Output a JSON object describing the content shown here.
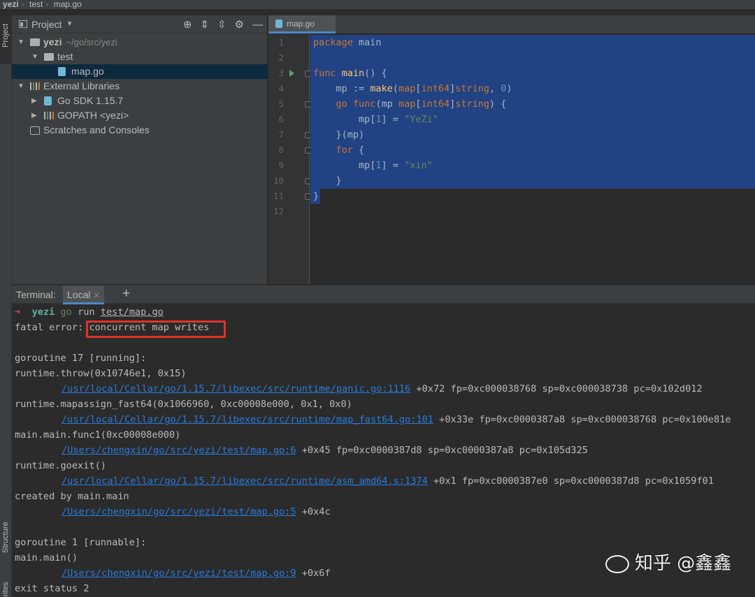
{
  "breadcrumb": {
    "items": [
      "yezi",
      "test",
      "map.go"
    ]
  },
  "sidebar": {
    "project_tab": "Project",
    "structure_tab": "Structure",
    "favorites_tab": "avorites"
  },
  "project_panel": {
    "title": "Project",
    "tree": [
      {
        "label": "yezi",
        "note": "~/go/src/yezi",
        "level": 0,
        "type": "folder",
        "expanded": true,
        "bold": true
      },
      {
        "label": "test",
        "level": 1,
        "type": "folder",
        "expanded": true
      },
      {
        "label": "map.go",
        "level": 2,
        "type": "go-file",
        "selected": true
      },
      {
        "label": "External Libraries",
        "level": 0,
        "type": "library",
        "expanded": true
      },
      {
        "label": "Go SDK 1.15.7",
        "level": 1,
        "type": "go-file",
        "expanded": false
      },
      {
        "label": "GOPATH <yezi>",
        "level": 1,
        "type": "library",
        "expanded": false
      },
      {
        "label": "Scratches and Consoles",
        "level": 0,
        "type": "scratch"
      }
    ]
  },
  "editor": {
    "tab_label": "map.go",
    "line_numbers": [
      "1",
      "2",
      "3",
      "4",
      "5",
      "6",
      "7",
      "8",
      "9",
      "10",
      "11",
      "12"
    ],
    "lines": [
      [
        [
          "kw",
          "package"
        ],
        [
          "t",
          " main"
        ]
      ],
      [],
      [
        [
          "kw",
          "func"
        ],
        [
          "t",
          " "
        ],
        [
          "fn",
          "main"
        ],
        [
          "t",
          "() {"
        ]
      ],
      [
        [
          "t",
          "    mp := "
        ],
        [
          "fn",
          "make"
        ],
        [
          "t",
          "("
        ],
        [
          "kw",
          "map"
        ],
        [
          "t",
          "["
        ],
        [
          "kw",
          "int64"
        ],
        [
          "t",
          "]"
        ],
        [
          "kw",
          "string"
        ],
        [
          "t",
          ", "
        ],
        [
          "nm",
          "0"
        ],
        [
          "t",
          ")"
        ]
      ],
      [
        [
          "t",
          "    "
        ],
        [
          "kw",
          "go"
        ],
        [
          "t",
          " "
        ],
        [
          "kw",
          "func"
        ],
        [
          "t",
          "(mp "
        ],
        [
          "kw",
          "map"
        ],
        [
          "t",
          "["
        ],
        [
          "kw",
          "int64"
        ],
        [
          "t",
          "]"
        ],
        [
          "kw",
          "string"
        ],
        [
          "t",
          ") {"
        ]
      ],
      [
        [
          "t",
          "        mp["
        ],
        [
          "nm",
          "1"
        ],
        [
          "t",
          "] = "
        ],
        [
          "st",
          "\"YeZi\""
        ]
      ],
      [
        [
          "t",
          "    }(mp)"
        ]
      ],
      [
        [
          "t",
          "    "
        ],
        [
          "kw",
          "for"
        ],
        [
          "t",
          " {"
        ]
      ],
      [
        [
          "t",
          "        mp["
        ],
        [
          "nm",
          "1"
        ],
        [
          "t",
          "] = "
        ],
        [
          "st",
          "\"xin\""
        ]
      ],
      [
        [
          "t",
          "    }"
        ]
      ],
      [
        [
          "t",
          "}"
        ]
      ],
      []
    ]
  },
  "terminal": {
    "label": "Terminal:",
    "tab": "Local",
    "prompt_arrow": "➜",
    "prompt_dir": "yezi",
    "prompt_cmd": "go",
    "prompt_run": "run",
    "prompt_file": "test/map.go",
    "fatal_prefix": "fatal error: ",
    "fatal_msg": "concurrent map writes",
    "lines": [
      {
        "text": "goroutine 17 [running]:"
      },
      {
        "text": "runtime.throw(0x10746e1, 0x15)"
      },
      {
        "link": "/usr/local/Cellar/go/1.15.7/libexec/src/runtime/panic.go:1116",
        "rest": " +0x72 fp=0xc000038768 sp=0xc000038738 pc=0x102d012",
        "indent": true
      },
      {
        "text": "runtime.mapassign_fast64(0x1066960, 0xc00008e000, 0x1, 0x0)"
      },
      {
        "link": "/usr/local/Cellar/go/1.15.7/libexec/src/runtime/map_fast64.go:101",
        "rest": " +0x33e fp=0xc0000387a8 sp=0xc000038768 pc=0x100e81e",
        "indent": true
      },
      {
        "text": "main.main.func1(0xc00008e000)"
      },
      {
        "link": "/Users/chengxin/go/src/yezi/test/map.go:6",
        "rest": " +0x45 fp=0xc0000387d8 sp=0xc0000387a8 pc=0x105d325",
        "indent": true
      },
      {
        "text": "runtime.goexit()"
      },
      {
        "link": "/usr/local/Cellar/go/1.15.7/libexec/src/runtime/asm_amd64.s:1374",
        "rest": " +0x1 fp=0xc0000387e0 sp=0xc0000387d8 pc=0x1059f01",
        "indent": true
      },
      {
        "text": "created by main.main"
      },
      {
        "link": "/Users/chengxin/go/src/yezi/test/map.go:5",
        "rest": " +0x4c",
        "indent": true
      },
      {
        "text": ""
      },
      {
        "text": "goroutine 1 [runnable]:"
      },
      {
        "text": "main.main()"
      },
      {
        "link": "/Users/chengxin/go/src/yezi/test/map.go:9",
        "rest": " +0x6f",
        "indent": true
      },
      {
        "text": "exit status 2"
      }
    ]
  },
  "watermark": "知乎 @鑫鑫",
  "colors": {
    "selection": "#214283",
    "keyword": "#cc7832",
    "function": "#ffc66d",
    "string": "#6a8759",
    "number": "#6897bb",
    "link": "#287bde",
    "highlight_box": "#e0322a"
  }
}
